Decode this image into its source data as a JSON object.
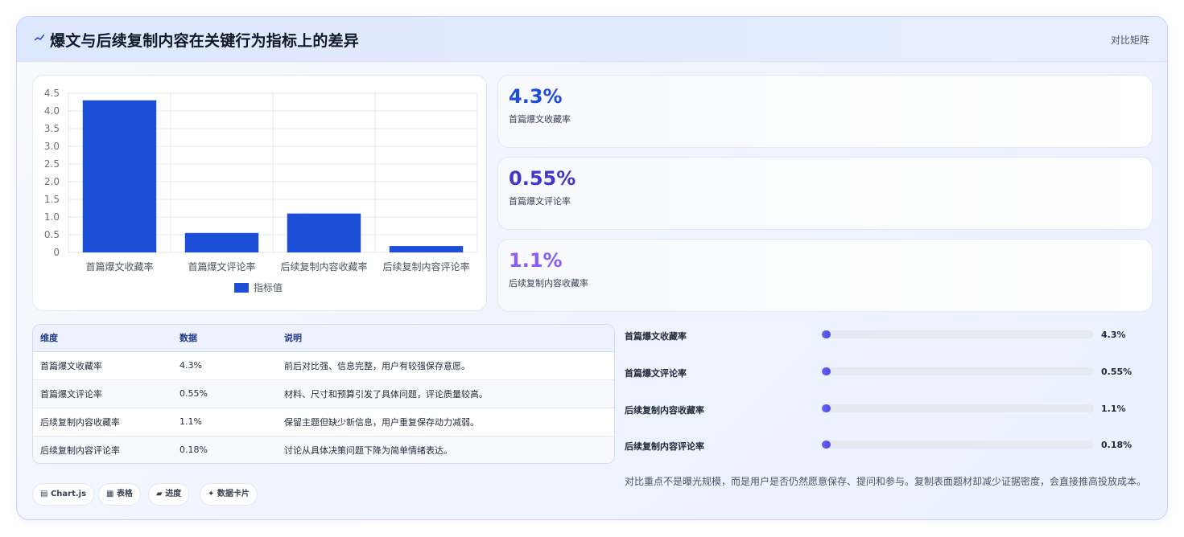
{
  "header": {
    "title": "爆文与后续复制内容在关键行为指标上的差异",
    "right_link": "对比矩阵"
  },
  "chart_data": {
    "type": "bar",
    "categories": [
      "首篇爆文收藏率",
      "首篇爆文评论率",
      "后续复制内容收藏率",
      "后续复制内容评论率"
    ],
    "series": [
      {
        "name": "指标值",
        "values": [
          4.3,
          0.55,
          1.1,
          0.18
        ],
        "color": "#1d4ed8"
      }
    ],
    "ylim": [
      0,
      4.5
    ],
    "yticks": [
      "0",
      "0.5",
      "1.0",
      "1.5",
      "2.0",
      "2.5",
      "3.0",
      "3.5",
      "4.0",
      "4.5"
    ],
    "ytick_values": [
      0,
      0.5,
      1.0,
      1.5,
      2.0,
      2.5,
      3.0,
      3.5,
      4.0,
      4.5
    ],
    "legend": "bottom",
    "grid": true
  },
  "stats": [
    {
      "value": "4.3%",
      "label": "首篇爆文收藏率",
      "color": "#1d4ed8"
    },
    {
      "value": "0.55%",
      "label": "首篇爆文评论率",
      "color": "#4338ca"
    },
    {
      "value": "1.1%",
      "label": "后续复制内容收藏率",
      "color": "#8b5cf6"
    }
  ],
  "table": {
    "headers": [
      "维度",
      "数据",
      "说明"
    ],
    "rows": [
      [
        "首篇爆文收藏率",
        "4.3%",
        "前后对比强、信息完整，用户有较强保存意愿。"
      ],
      [
        "首篇爆文评论率",
        "0.55%",
        "材料、尺寸和预算引发了具体问题，评论质量较高。"
      ],
      [
        "后续复制内容收藏率",
        "1.1%",
        "保留主题但缺少新信息，用户重复保存动力减弱。"
      ],
      [
        "后续复制内容评论率",
        "0.18%",
        "讨论从具体决策问题下降为简单情绪表达。"
      ]
    ]
  },
  "progress": [
    {
      "label": "首篇爆文收藏率",
      "value": "4.3%",
      "fraction": 0.0
    },
    {
      "label": "首篇爆文评论率",
      "value": "0.55%",
      "fraction": 0.0
    },
    {
      "label": "后续复制内容收藏率",
      "value": "1.1%",
      "fraction": 0.0
    },
    {
      "label": "后续复制内容评论率",
      "value": "0.18%",
      "fraction": 0.0
    }
  ],
  "note": "对比重点不是曝光规模，而是用户是否仍然愿意保存、提问和参与。复制表面题材却减少证据密度，会直接推高投放成本。",
  "tags": [
    {
      "icon": "▤",
      "label": "Chart.js"
    },
    {
      "icon": "▦",
      "label": "表格"
    },
    {
      "icon": "▰",
      "label": "进度"
    },
    {
      "icon": "✦",
      "label": "数据卡片"
    }
  ],
  "icons": {
    "title": "line-chart-icon",
    "accent": "#1d4ed8"
  }
}
